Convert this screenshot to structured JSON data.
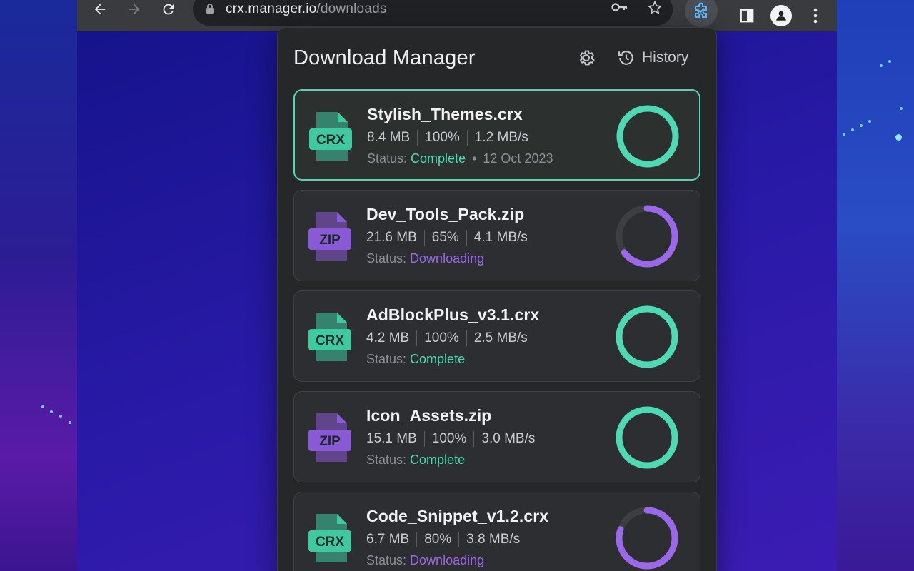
{
  "browser": {
    "url_host": "crx.manager.io",
    "url_path": "/downloads"
  },
  "popup": {
    "title": "Download Manager",
    "history_label": "History"
  },
  "status_prefix": "Status:",
  "colors": {
    "complete": "#4fd8b4",
    "downloading": "#9a68e8",
    "crx_icon": "#3fc9a0",
    "zip_icon": "#8a5ad6"
  },
  "downloads": [
    {
      "name": "Stylish_Themes.crx",
      "type": "CRX",
      "size": "8.4 MB",
      "percent": "100%",
      "progress": 1.0,
      "speed": "1.2 MB/s",
      "status": "Complete",
      "date": "12 Oct 2023",
      "active": true
    },
    {
      "name": "Dev_Tools_Pack.zip",
      "type": "ZIP",
      "size": "21.6 MB",
      "percent": "65%",
      "progress": 0.65,
      "speed": "4.1 MB/s",
      "status": "Downloading",
      "date": "",
      "active": false
    },
    {
      "name": "AdBlockPlus_v3.1.crx",
      "type": "CRX",
      "size": "4.2 MB",
      "percent": "100%",
      "progress": 1.0,
      "speed": "2.5 MB/s",
      "status": "Complete",
      "date": "",
      "active": false
    },
    {
      "name": "Icon_Assets.zip",
      "type": "ZIP",
      "size": "15.1 MB",
      "percent": "100%",
      "progress": 1.0,
      "speed": "3.0 MB/s",
      "status": "Complete",
      "date": "",
      "active": false
    },
    {
      "name": "Code_Snippet_v1.2.crx",
      "type": "CRX",
      "size": "6.7 MB",
      "percent": "80%",
      "progress": 0.8,
      "speed": "3.8 MB/s",
      "status": "Downloading",
      "date": "",
      "active": false
    }
  ]
}
